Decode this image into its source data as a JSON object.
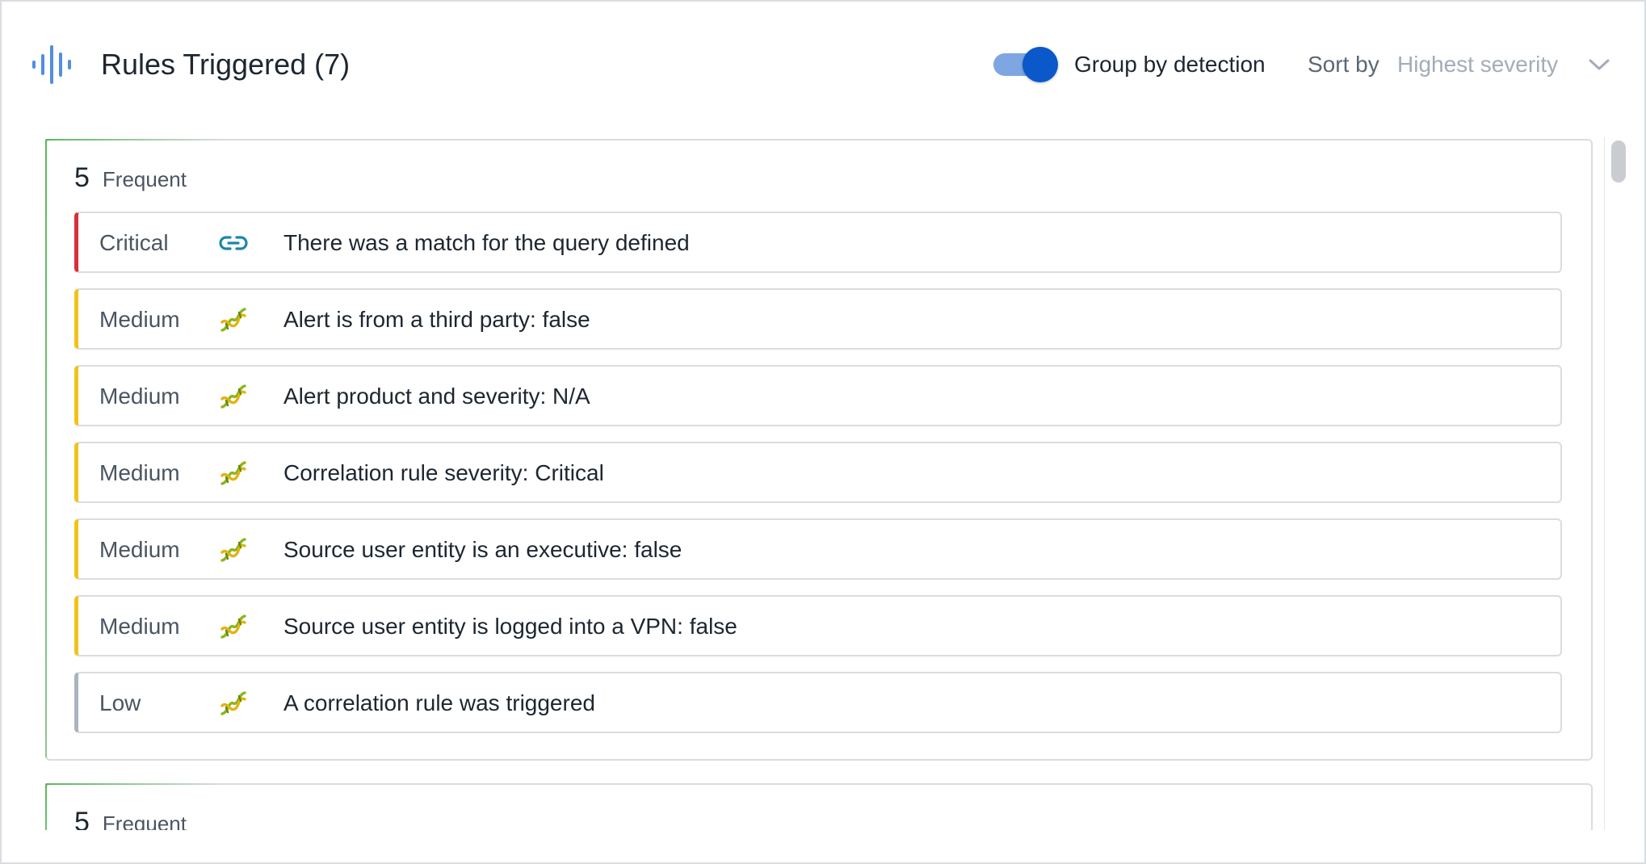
{
  "header": {
    "title": "Rules Triggered (7)",
    "group_toggle_label": "Group by detection",
    "group_toggle_on": true,
    "sort_label": "Sort by",
    "sort_value": "Highest severity",
    "icon": "audio-waveform-icon"
  },
  "colors": {
    "accent": "#0a58ca",
    "toggle_track": "#7ea6e0",
    "critical": "#d92f3a",
    "medium": "#f2c21b",
    "low": "#a9b4c2",
    "group_accent": "#5bb85b",
    "link_icon": "#1b87a8"
  },
  "groups": [
    {
      "count": "5",
      "label": "Frequent",
      "rows": [
        {
          "severity": "Critical",
          "icon": "link-icon",
          "text": "There was a match for the query defined"
        },
        {
          "severity": "Medium",
          "icon": "dna-icon",
          "text": "Alert is from a third party: false"
        },
        {
          "severity": "Medium",
          "icon": "dna-icon",
          "text": "Alert product and severity: N/A"
        },
        {
          "severity": "Medium",
          "icon": "dna-icon",
          "text": "Correlation rule severity: Critical"
        },
        {
          "severity": "Medium",
          "icon": "dna-icon",
          "text": "Source user entity is an executive: false"
        },
        {
          "severity": "Medium",
          "icon": "dna-icon",
          "text": "Source user entity is logged into a VPN: false"
        },
        {
          "severity": "Low",
          "icon": "dna-icon",
          "text": "A correlation rule was triggered"
        }
      ]
    },
    {
      "count": "5",
      "label": "Frequent",
      "rows": []
    }
  ]
}
